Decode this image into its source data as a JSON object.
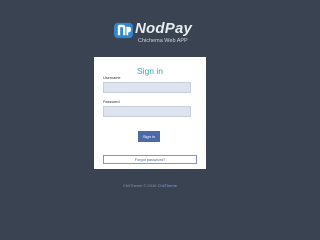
{
  "logo": {
    "title": "NodPay",
    "subtitle": "Chichema Web APP"
  },
  "login": {
    "title": "Sign in",
    "username_label": "Username",
    "username_value": "",
    "password_label": "Password",
    "password_value": "",
    "signin_label": "Sign in",
    "forgot_label": "Forgot password?"
  },
  "footer": {
    "text": "ChiiTheme © 2016",
    "link": "ChiiTheme"
  },
  "colors": {
    "background": "#394352",
    "accent": "#3aa8a8",
    "button": "#4d6aa8",
    "input_bg": "#dee4ed"
  }
}
